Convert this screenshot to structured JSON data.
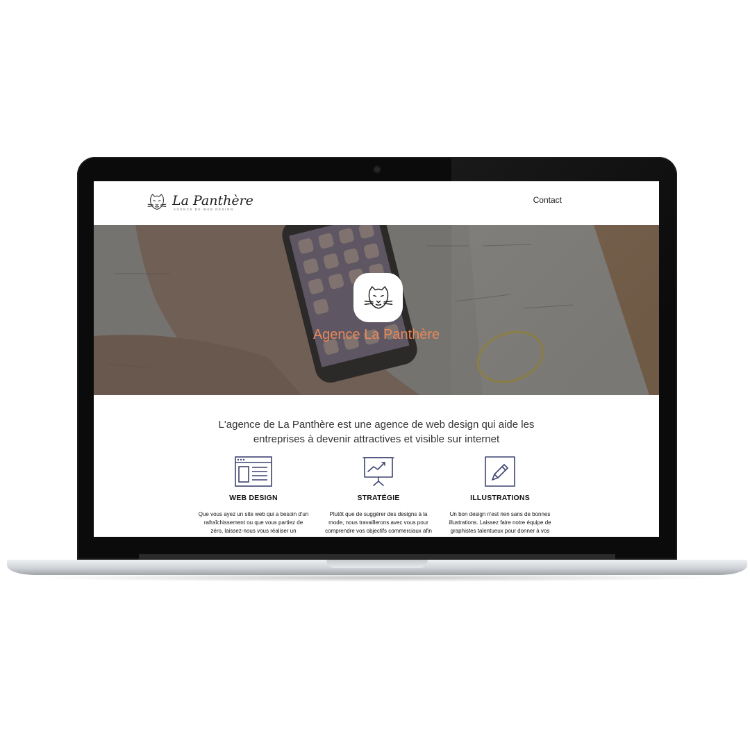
{
  "nav": {
    "logo_name": "La Panthère",
    "logo_tagline": "AGENCE DE WEB DESIGN",
    "contact_label": "Contact"
  },
  "hero": {
    "title": "Agence La Panthère"
  },
  "intro": {
    "text": "L'agence de La Panthère est une agence de web design qui aide les entreprises à devenir attractives et visible sur internet"
  },
  "features": [
    {
      "icon": "browser-window-icon",
      "title": "WEB DESIGN",
      "description": "Que vous ayez un site web qui a besoin d'un rafraîchissement ou que vous partiez de zéro, laissez-nous vous réaliser un"
    },
    {
      "icon": "presentation-chart-icon",
      "title": "STRATÉGIE",
      "description": "Plutôt que de suggérer des designs à la mode, nous travaillerons avec vous pour comprendre vos objectifs commerciaux afin"
    },
    {
      "icon": "pencil-icon",
      "title": "ILLUSTRATIONS",
      "description": "Un bon design n'est rien sans de bonnes illustrations. Laissez faire notre équipe de graphistes talentueux pour donner à vos"
    }
  ],
  "colors": {
    "accent": "#e6895b",
    "icon_stroke": "#3d4470"
  }
}
